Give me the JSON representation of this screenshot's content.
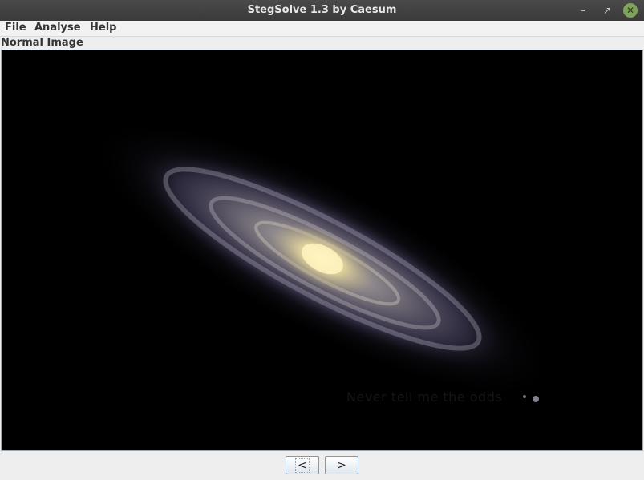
{
  "window": {
    "title": "StegSolve 1.3 by Caesum",
    "controls": {
      "minimize_icon": "minimize-icon",
      "maximize_icon": "maximize-icon",
      "close_icon": "close-icon",
      "close_color": "#7fa35a"
    }
  },
  "menubar": {
    "items": [
      {
        "label": "File"
      },
      {
        "label": "Analyse"
      },
      {
        "label": "Help"
      }
    ]
  },
  "viewer": {
    "caption": "Normal Image",
    "image_description": "galaxy-image",
    "embedded_text": "Never tell me the odds",
    "background": "#000000"
  },
  "navigation": {
    "prev_label": "<",
    "next_label": ">"
  }
}
